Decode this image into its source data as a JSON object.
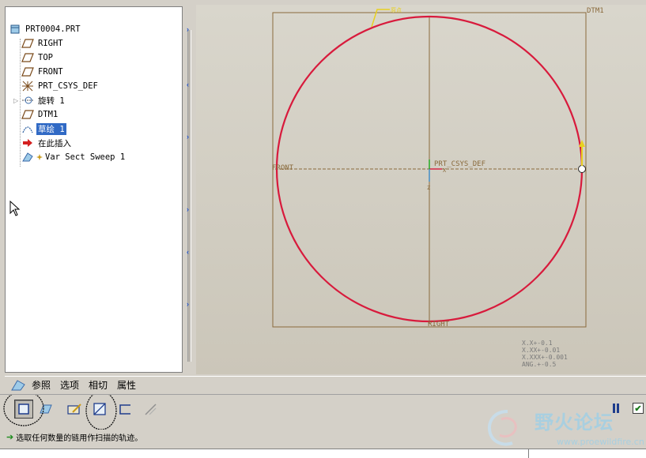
{
  "model_tree": {
    "items": [
      {
        "label": "PRT0004.PRT",
        "icon": "part-icon"
      },
      {
        "label": "RIGHT",
        "icon": "datum-plane-icon"
      },
      {
        "label": "TOP",
        "icon": "datum-plane-icon"
      },
      {
        "label": "FRONT",
        "icon": "datum-plane-icon"
      },
      {
        "label": "PRT_CSYS_DEF",
        "icon": "csys-icon"
      },
      {
        "label": "旋转 1",
        "icon": "revolve-icon"
      },
      {
        "label": "DTM1",
        "icon": "datum-plane-icon"
      },
      {
        "label": "草绘 1",
        "icon": "sketch-icon",
        "selected": true
      },
      {
        "label": "在此插入",
        "icon": "insert-here-arrow-icon"
      },
      {
        "label": "Var Sect Sweep 1",
        "icon": "var-sect-sweep-icon"
      }
    ]
  },
  "graphics": {
    "labels": {
      "dtm1": "DTM1",
      "front": "FRONT",
      "right": "RIGHT",
      "csys": "PRT_CSYS_DEF",
      "origin_x": "X",
      "origin_z": "Z",
      "callout": "原点"
    },
    "tolerances": [
      "X.X+-0.1",
      "X.XX+-0.01",
      "X.XXX+-0.001",
      "ANG.+-0.5"
    ],
    "colors": {
      "trajectory": "#d81a3c",
      "datum": "#8a6a3c",
      "background": "#d2cec3"
    }
  },
  "tabs": [
    "参照",
    "选项",
    "相切",
    "属性"
  ],
  "toolbar": {
    "buttons": [
      "variable-section-button",
      "constant-section-button",
      "sketch-section-button",
      "solid-button",
      "surface-button",
      "remove-material-button"
    ]
  },
  "watermark": {
    "title": "野火论坛",
    "url": "www.proewildfire.cn"
  },
  "status": {
    "message": "选取任何数量的链用作扫描的轨迹。"
  }
}
